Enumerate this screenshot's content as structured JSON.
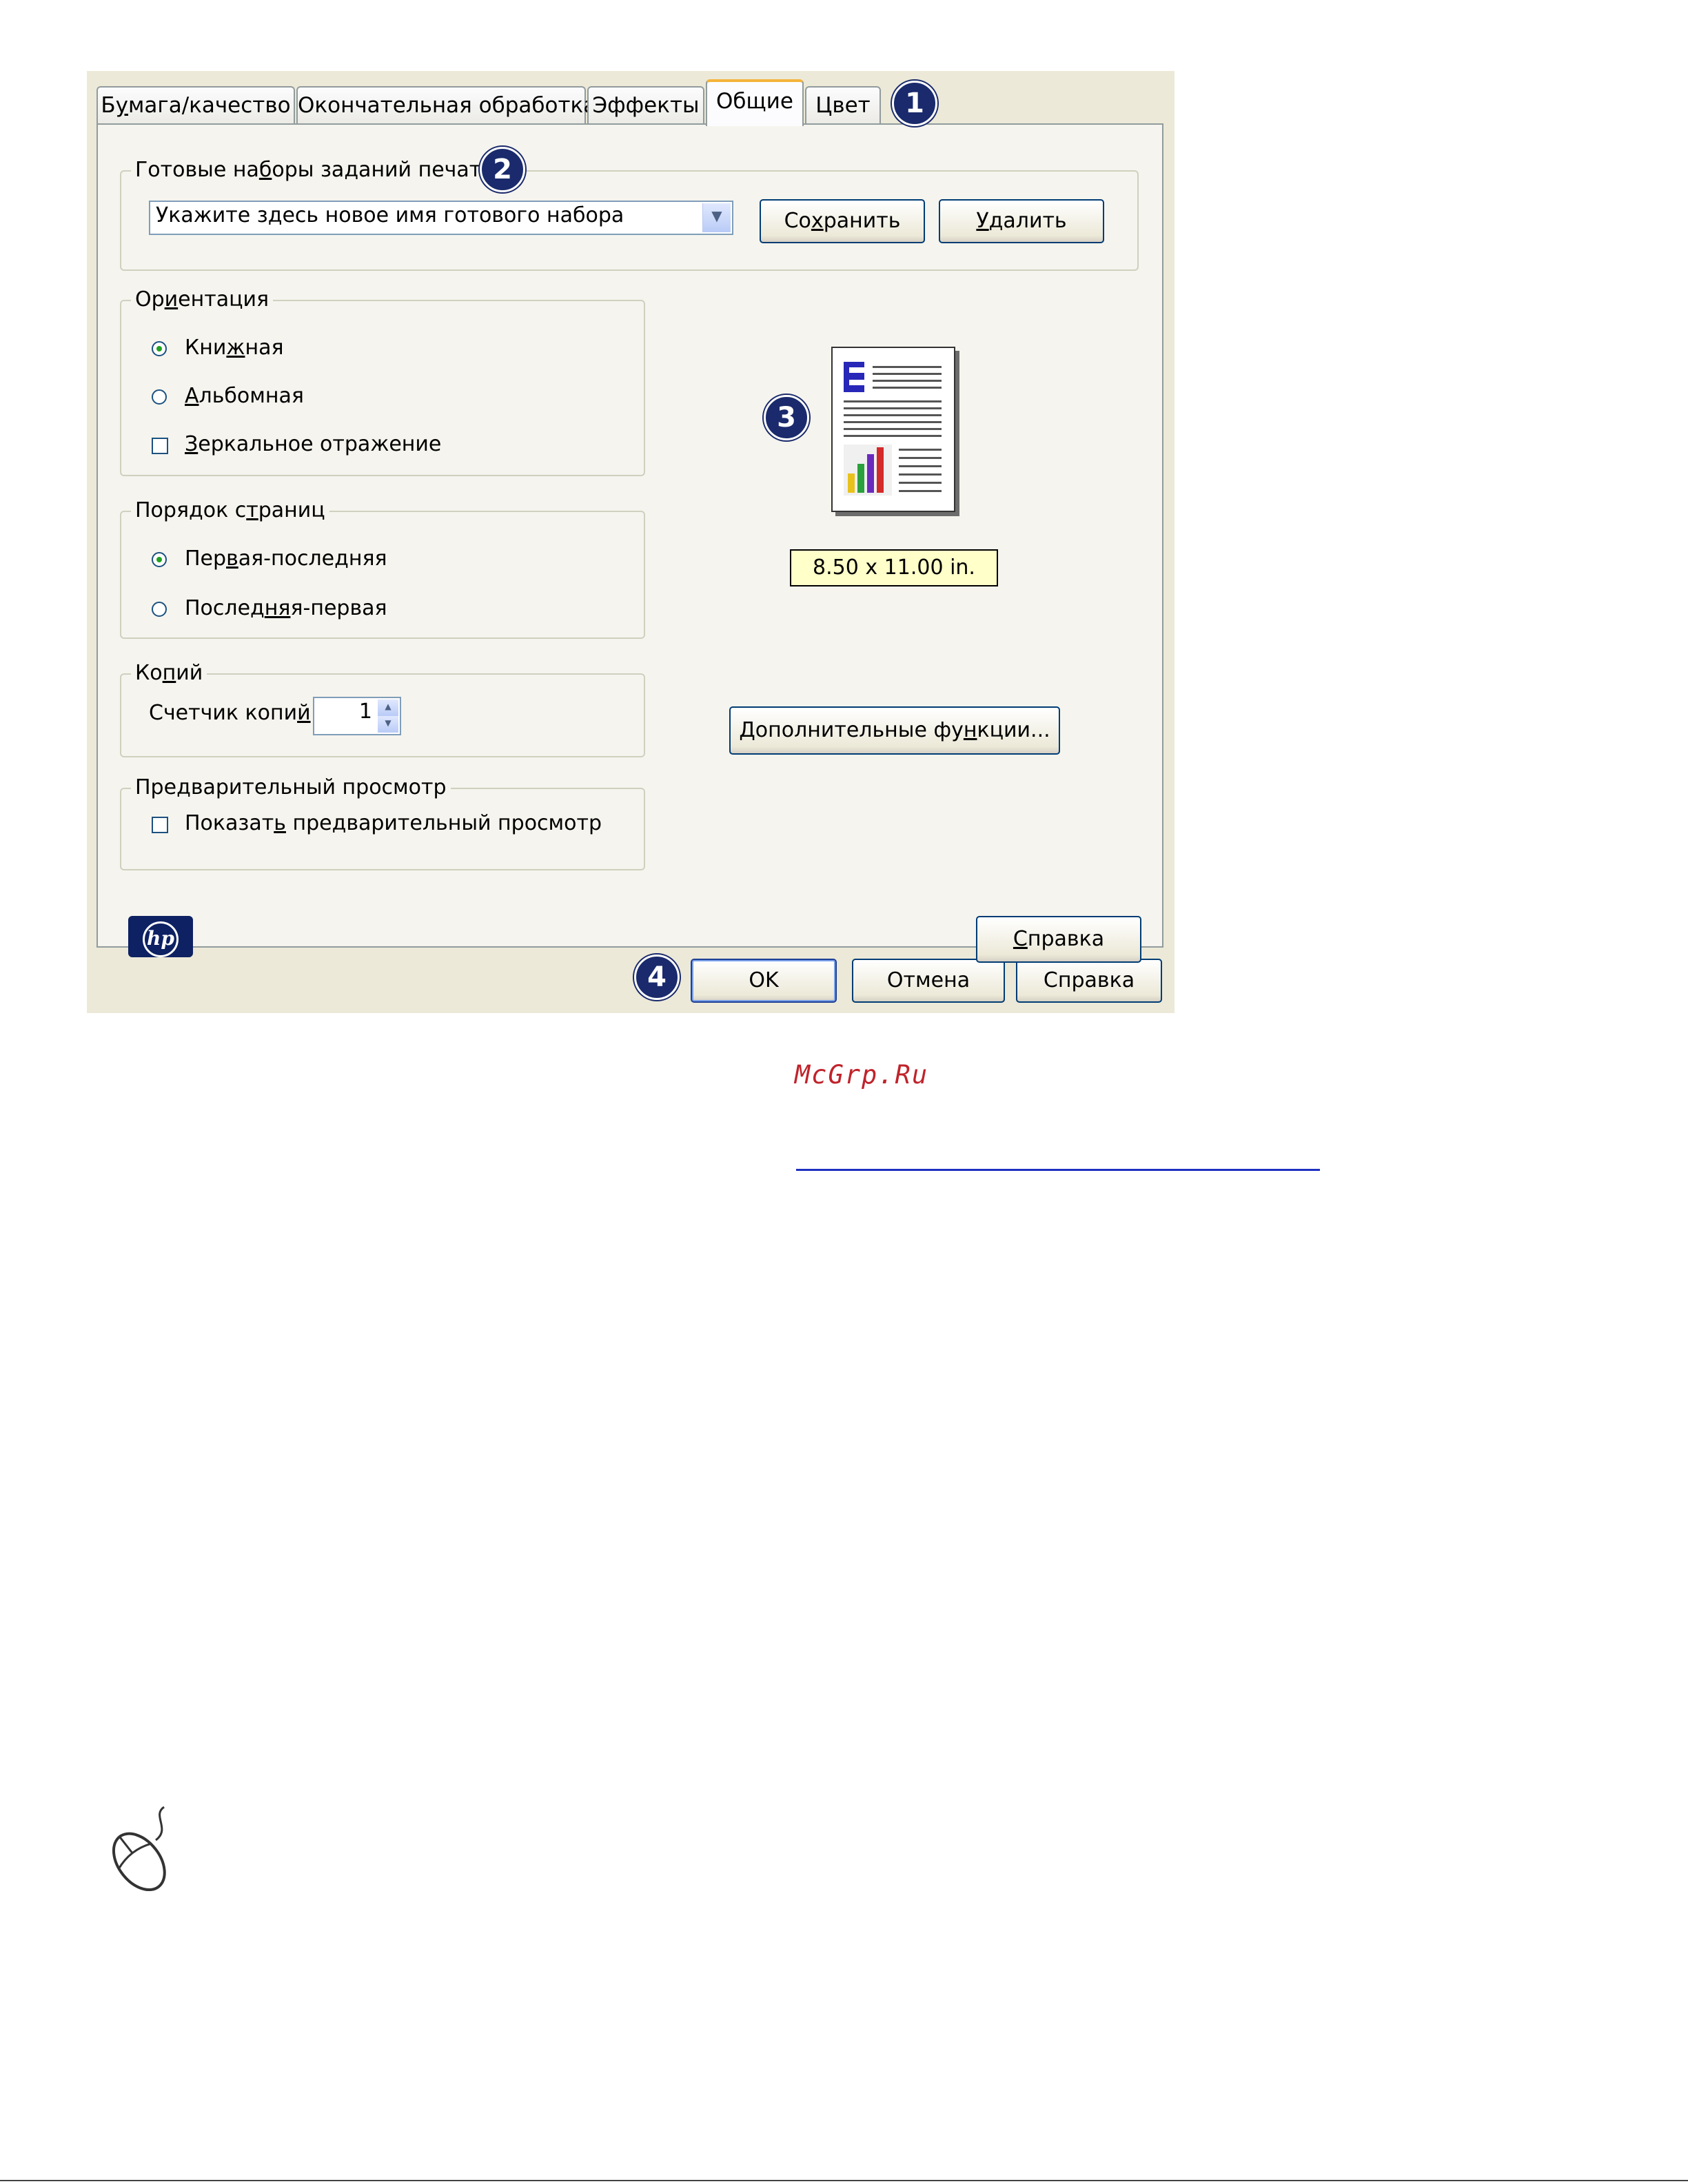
{
  "dialog": {
    "tabs": [
      {
        "label": "Бумага/качество",
        "underline_index": 1
      },
      {
        "label": "Окончательная обработка"
      },
      {
        "label": "Эффекты"
      },
      {
        "label": "Общие",
        "active": true
      },
      {
        "label": "Цвет"
      }
    ],
    "presets": {
      "legend_before": "Готовые на",
      "legend_u": "б",
      "legend_after": "оры заданий печати",
      "combo_value": "Укажите здесь новое имя готового набора",
      "save_before": "Со",
      "save_u": "х",
      "save_after": "ранить",
      "delete_u": "У",
      "delete_after": "далить"
    },
    "orientation": {
      "legend_before": "Ор",
      "legend_u": "и",
      "legend_after": "ентация",
      "portrait_before": "Кни",
      "portrait_u": "ж",
      "portrait_after": "ная",
      "landscape_u": "А",
      "landscape_after": "льбомная",
      "mirror_u": "З",
      "mirror_after": "еркальное отражение",
      "selected": "portrait",
      "mirror_checked": false
    },
    "page_order": {
      "legend_before": "Порядок с",
      "legend_u": "т",
      "legend_after": "раниц",
      "first_last_before": "Пер",
      "first_last_u": "в",
      "first_last_after": "ая-последняя",
      "last_first_before": "Послед",
      "last_first_u": "ня",
      "last_first_after": "я-первая",
      "selected": "first_last"
    },
    "copies": {
      "legend_before": "Ко",
      "legend_u": "п",
      "legend_after": "ий",
      "counter_before": "Счетчик копи",
      "counter_u": "й",
      "value": "1"
    },
    "preview": {
      "legend_before": "Пре",
      "legend_u": "д",
      "legend_after": "варительный просмотр",
      "show_before": "Показат",
      "show_u": "ь",
      "show_after": " предварительный просмотр",
      "checked": false
    },
    "paper_size": "8.50 x 11.00 in.",
    "advanced_before": "Дополнительные фу",
    "advanced_u": "н",
    "advanced_after": "кции...",
    "help_u": "С",
    "help_after": "правка",
    "ok_label": "OK",
    "cancel_label": "Отмена",
    "help_bottom_label": "Справка",
    "logo_text": "hp",
    "callouts": [
      "1",
      "2",
      "3",
      "4"
    ]
  },
  "watermark": "McGrp.Ru",
  "colors": {
    "dialog_bg": "#ece9d8",
    "panel_bg": "#f5f4ee",
    "callout": "#1a2a6c",
    "watermark": "#c0232b",
    "link": "#1f30c0"
  },
  "icons": [
    "dropdown-arrow-icon",
    "spin-up-icon",
    "spin-down-icon",
    "page-preview-icon",
    "hp-logo",
    "mouse-icon"
  ]
}
